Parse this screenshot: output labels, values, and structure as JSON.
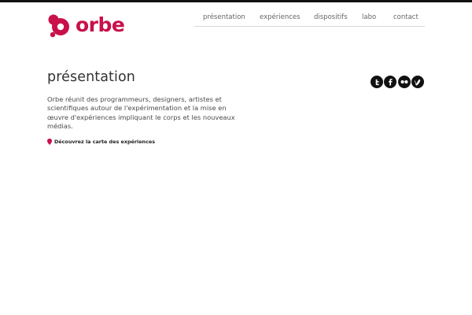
{
  "header": {
    "logo_text": "orbe",
    "brand_color": "#c8104a"
  },
  "nav": {
    "items": [
      {
        "label": "présentation"
      },
      {
        "label": "expériences"
      },
      {
        "label": "dispositifs"
      },
      {
        "label": "labo"
      },
      {
        "label": "contact"
      }
    ]
  },
  "main": {
    "title": "présentation",
    "intro": "Orbe réunit des programmeurs, designers, artistes et scientifiques autour de l'expérimentation et la mise en œuvre d'expériences impliquant le corps et les nouveaux médias.",
    "cta_label": "Découvrez la carte des expériences"
  },
  "social": {
    "icons": [
      "twitter-icon",
      "facebook-icon",
      "flickr-icon",
      "vimeo-icon"
    ]
  }
}
